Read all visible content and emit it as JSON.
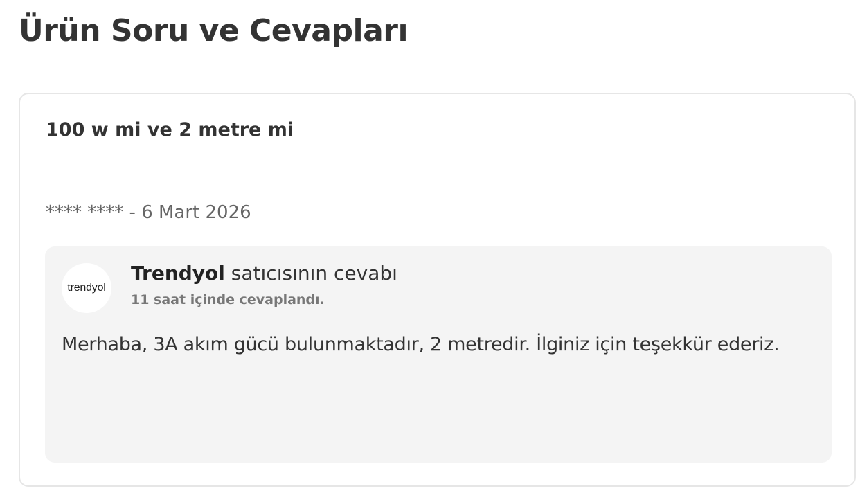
{
  "page": {
    "title": "Ürün Soru ve Cevapları"
  },
  "question": {
    "text": "100 w mi ve 2 metre mi",
    "author": "**** ****",
    "separator": " - ",
    "date": "6 Mart 2026"
  },
  "answer": {
    "seller_logo": "trendyol",
    "seller_name": "Trendyol",
    "seller_suffix": " satıcısının cevabı",
    "answered_time": "11 saat içinde cevaplandı.",
    "text": "Merhaba, 3A akım gücü bulunmaktadır, 2 metredir. İlginiz için teşekkür ederiz."
  },
  "colors": {
    "title": "#333333",
    "meta": "#666666",
    "answer_bg": "#f4f4f4",
    "card_border": "#e6e6e6"
  }
}
